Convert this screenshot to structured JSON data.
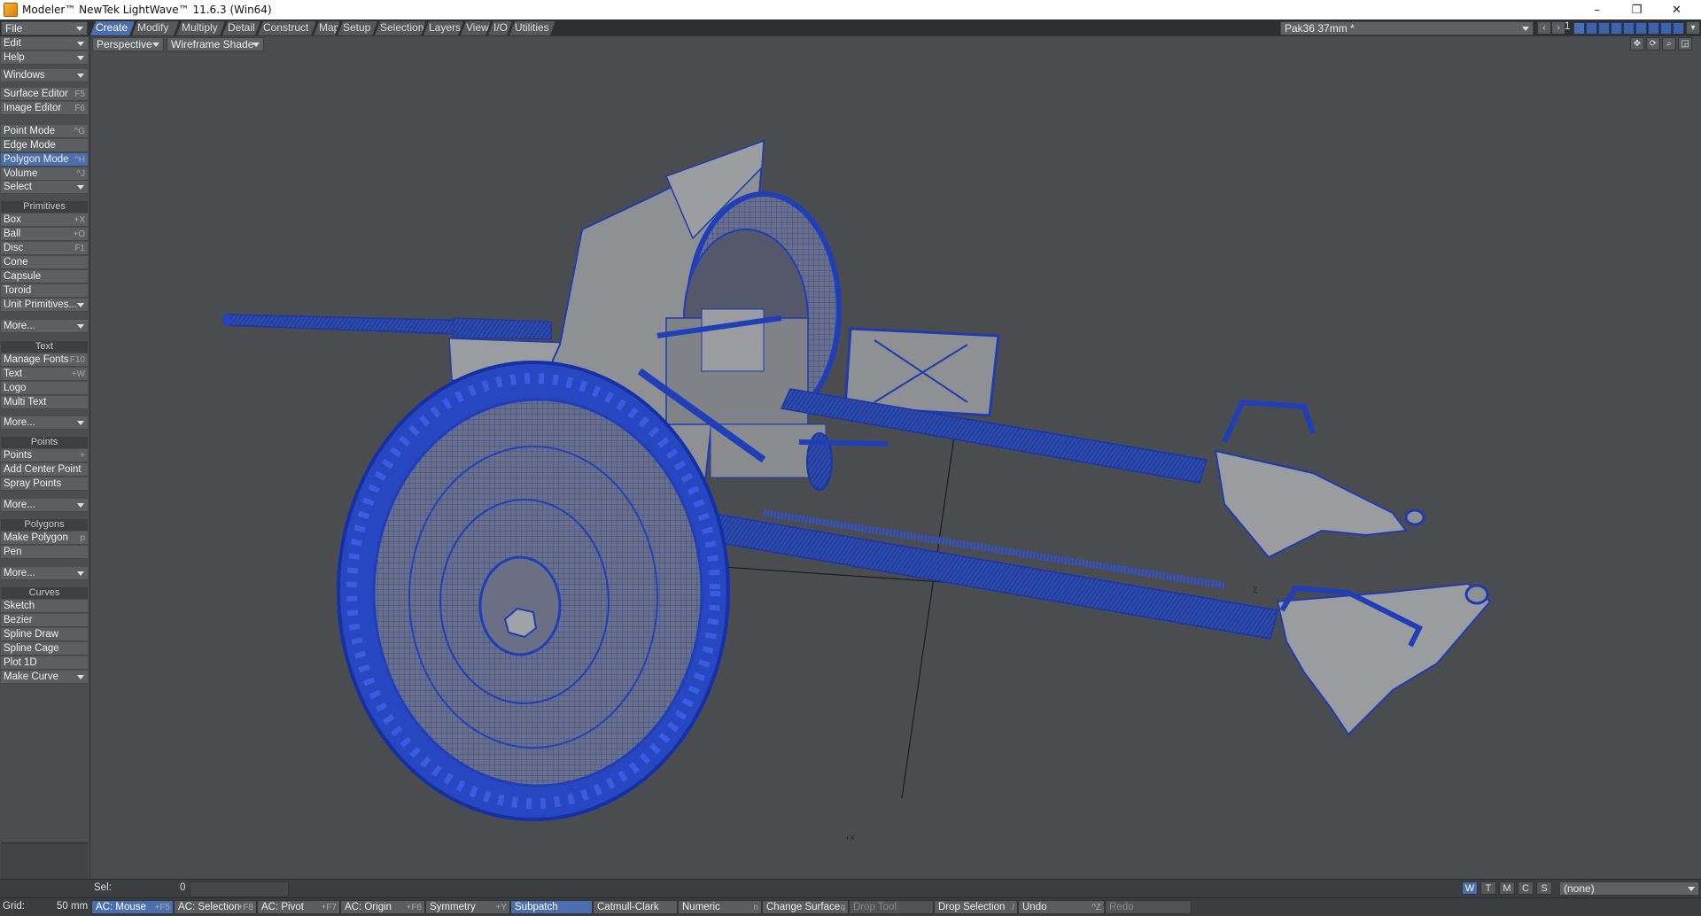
{
  "window": {
    "title": "Modeler™ NewTek LightWave™ 11.6.3 (Win64)",
    "controls": {
      "minimize": "–",
      "maximize": "❐",
      "close": "✕"
    }
  },
  "menu_tabs": [
    {
      "label": "Create",
      "active": true
    },
    {
      "label": "Modify"
    },
    {
      "label": "Multiply"
    },
    {
      "label": "Detail"
    },
    {
      "label": "Construct"
    },
    {
      "label": "Map"
    },
    {
      "label": "Setup"
    },
    {
      "label": "Selection"
    },
    {
      "label": "Layers"
    },
    {
      "label": "View"
    },
    {
      "label": "I/O"
    },
    {
      "label": "Utilities"
    }
  ],
  "object_selector": {
    "value": "Pak36 37mm *"
  },
  "layer_label": "1",
  "viewport": {
    "view_type": "Perspective",
    "render_mode": "Wireframe Shade",
    "axis_labels": {
      "x": "+X",
      "z": "Z"
    },
    "colors": {
      "background": "#4a4c4f",
      "wire": "#1f3fb8",
      "surface": "#8e9094"
    }
  },
  "sidebar": {
    "top_menus": [
      {
        "label": "File"
      },
      {
        "label": "Edit"
      },
      {
        "label": "Help"
      },
      {
        "label": "Windows"
      }
    ],
    "editors": [
      {
        "label": "Surface Editor",
        "shortcut": "F5"
      },
      {
        "label": "Image Editor",
        "shortcut": "F6"
      }
    ],
    "modes": [
      {
        "label": "Point Mode",
        "shortcut": "^G"
      },
      {
        "label": "Edge Mode",
        "shortcut": ""
      },
      {
        "label": "Polygon Mode",
        "shortcut": "^H",
        "active": true
      },
      {
        "label": "Volume",
        "shortcut": "^J"
      }
    ],
    "select": "Select",
    "primitives_header": "Primitives",
    "primitives": [
      {
        "label": "Box",
        "shortcut": "+X"
      },
      {
        "label": "Ball",
        "shortcut": "+O"
      },
      {
        "label": "Disc",
        "shortcut": "F1"
      },
      {
        "label": "Cone",
        "shortcut": ""
      },
      {
        "label": "Capsule",
        "shortcut": ""
      },
      {
        "label": "Toroid",
        "shortcut": ""
      },
      {
        "label": "Unit Primitives...",
        "shortcut": "",
        "dropdown": true
      }
    ],
    "more1": "More...",
    "text_header": "Text",
    "text_items": [
      {
        "label": "Manage Fonts",
        "shortcut": "F10"
      },
      {
        "label": "Text",
        "shortcut": "+W"
      },
      {
        "label": "Logo",
        "shortcut": ""
      },
      {
        "label": "Multi Text",
        "shortcut": ""
      }
    ],
    "more2": "More...",
    "points_header": "Points",
    "points_items": [
      {
        "label": "Points",
        "shortcut": "+"
      },
      {
        "label": "Add Center Point",
        "shortcut": ""
      },
      {
        "label": "Spray Points",
        "shortcut": ""
      }
    ],
    "more3": "More...",
    "polygons_header": "Polygons",
    "polygons_items": [
      {
        "label": "Make Polygon",
        "shortcut": "p"
      },
      {
        "label": "Pen",
        "shortcut": ""
      }
    ],
    "more4": "More...",
    "curves_header": "Curves",
    "curves_items": [
      {
        "label": "Sketch",
        "shortcut": ""
      },
      {
        "label": "Bezier",
        "shortcut": ""
      },
      {
        "label": "Spline Draw",
        "shortcut": ""
      },
      {
        "label": "Spline Cage",
        "shortcut": ""
      },
      {
        "label": "Plot 1D",
        "shortcut": ""
      },
      {
        "label": "Make Curve",
        "shortcut": "",
        "dropdown": true
      }
    ]
  },
  "status": {
    "sel_label": "Sel:",
    "sel_value": "0",
    "view_buttons": [
      {
        "label": "W",
        "active": true
      },
      {
        "label": "T"
      },
      {
        "label": "M"
      },
      {
        "label": "C"
      },
      {
        "label": "S"
      }
    ],
    "surface_select": "(none)"
  },
  "bottom": {
    "grid_label": "Grid:",
    "grid_value": "50 mm",
    "buttons": [
      {
        "label": "AC: Mouse",
        "shortcut": "+F5",
        "active": true
      },
      {
        "label": "AC: Selection",
        "shortcut": "+F8"
      },
      {
        "label": "AC: Pivot",
        "shortcut": "+F7"
      },
      {
        "label": "AC: Origin",
        "shortcut": "+F6"
      },
      {
        "label": "Symmetry",
        "shortcut": "+Y"
      },
      {
        "label": "Subpatch",
        "shortcut": "",
        "active": true
      },
      {
        "label": "Catmull-Clark",
        "shortcut": ""
      },
      {
        "label": "Numeric",
        "shortcut": "n"
      },
      {
        "label": "Change Surface",
        "shortcut": "q"
      },
      {
        "label": "Drop Tool",
        "shortcut": "",
        "disabled": true
      },
      {
        "label": "Drop Selection",
        "shortcut": "/"
      },
      {
        "label": "Undo",
        "shortcut": "^Z"
      },
      {
        "label": "Redo",
        "shortcut": "",
        "disabled": true
      }
    ]
  }
}
